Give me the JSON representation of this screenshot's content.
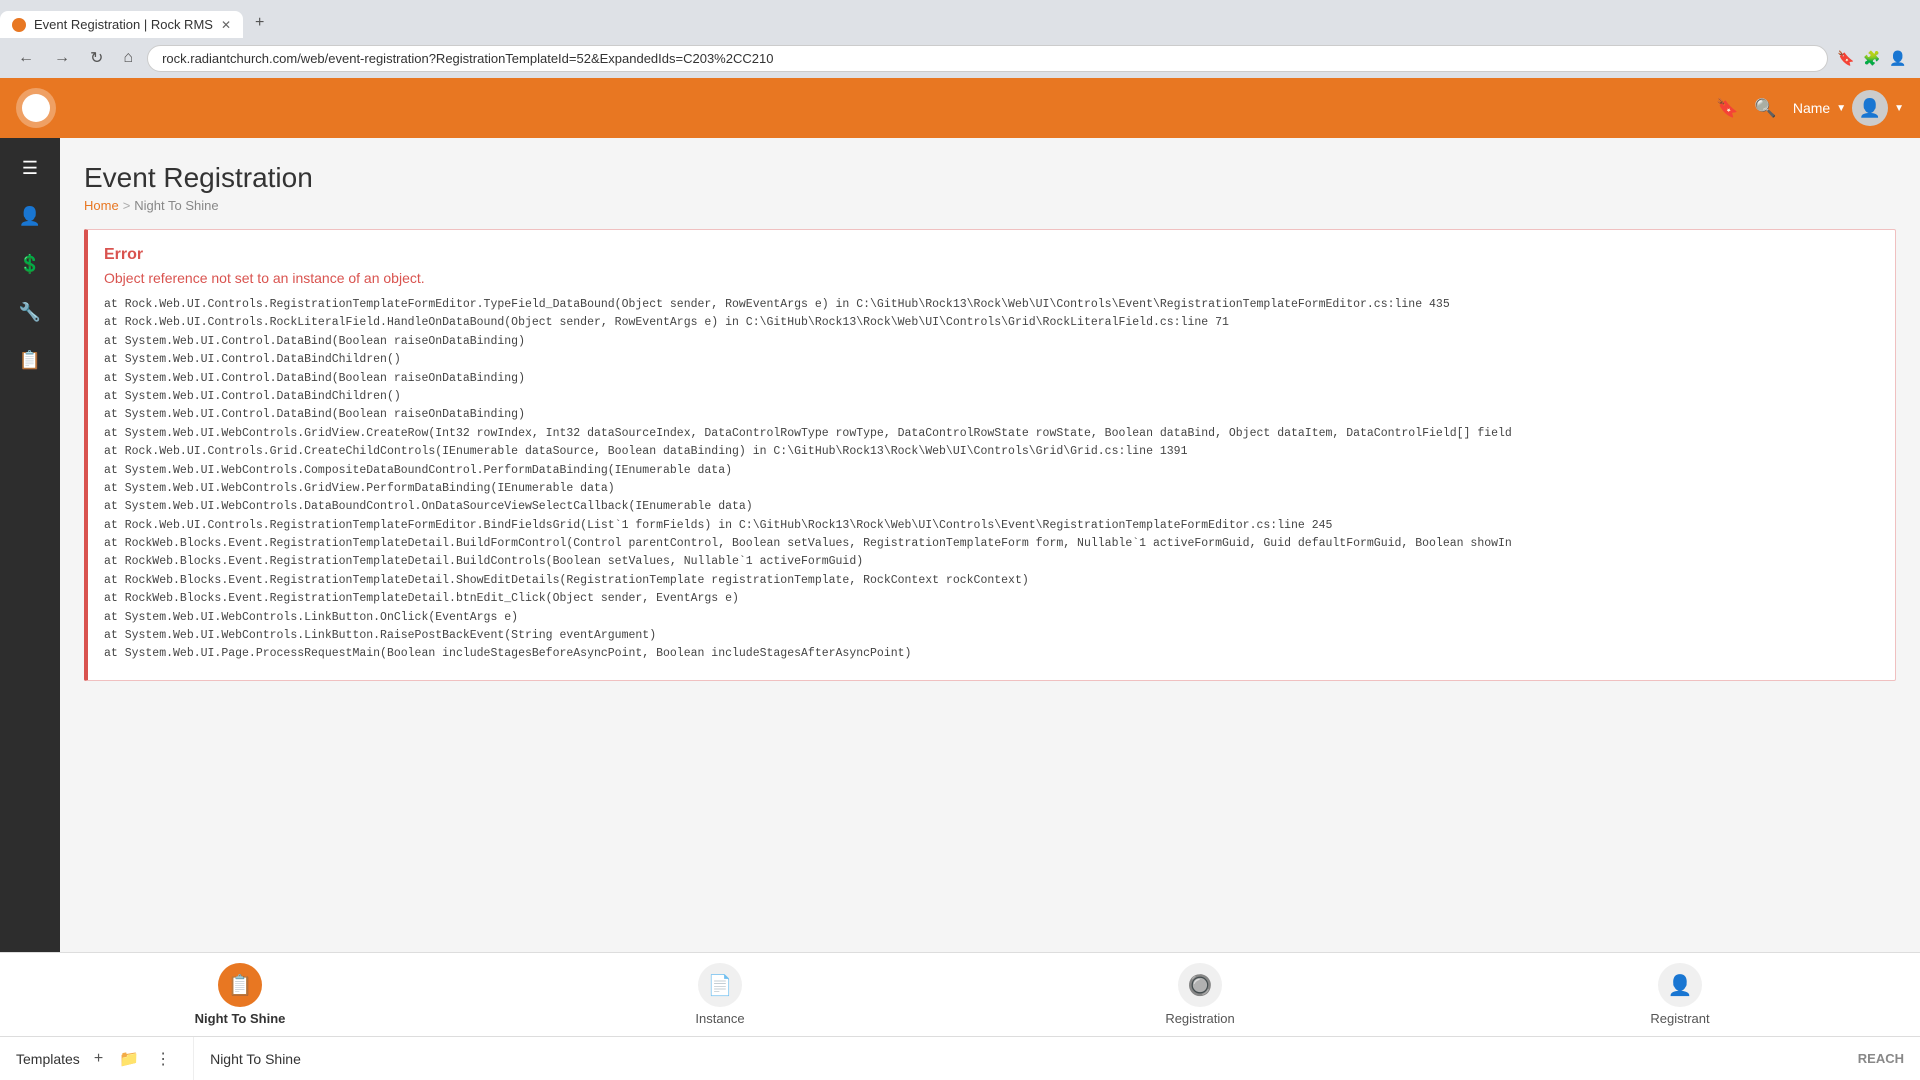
{
  "browser": {
    "tab_title": "Event Registration | Rock RMS",
    "tab_favicon": "🪨",
    "url": "rock.radiantchurch.com/web/event-registration?RegistrationTemplateId=52&ExpandedIds=C203%2CC210",
    "nav_back": "←",
    "nav_forward": "→",
    "nav_refresh": "↻",
    "nav_home": "⌂"
  },
  "top_nav": {
    "user_name": "Name",
    "bookmark_icon": "bookmark",
    "search_icon": "search"
  },
  "sidebar": {
    "items": [
      {
        "icon": "☰",
        "name": "menu"
      },
      {
        "icon": "👤",
        "name": "person"
      },
      {
        "icon": "💲",
        "name": "finance"
      },
      {
        "icon": "🔧",
        "name": "tools"
      },
      {
        "icon": "📋",
        "name": "reports"
      }
    ]
  },
  "page": {
    "title": "Event Registration",
    "breadcrumb_home": "Home",
    "breadcrumb_sep": ">",
    "breadcrumb_current": "Night To Shine"
  },
  "error": {
    "title": "Error",
    "message": "Object reference not set to an instance of an object.",
    "stack_lines": [
      "   at Rock.Web.UI.Controls.RegistrationTemplateFormEditor.TypeField_DataBound(Object sender, RowEventArgs e) in C:\\GitHub\\Rock13\\Rock\\Web\\UI\\Controls\\Event\\RegistrationTemplateFormEditor.cs:line 435",
      "   at Rock.Web.UI.Controls.RockLiteralField.HandleOnDataBound(Object sender, RowEventArgs e) in C:\\GitHub\\Rock13\\Rock\\Web\\UI\\Controls\\Grid\\RockLiteralField.cs:line 71",
      "   at System.Web.UI.Control.DataBind(Boolean raiseOnDataBinding)",
      "   at System.Web.UI.Control.DataBindChildren()",
      "   at System.Web.UI.Control.DataBind(Boolean raiseOnDataBinding)",
      "   at System.Web.UI.Control.DataBindChildren()",
      "   at System.Web.UI.Control.DataBind(Boolean raiseOnDataBinding)",
      "   at System.Web.UI.WebControls.GridView.CreateRow(Int32 rowIndex, Int32 dataSourceIndex, DataControlRowType rowType, DataControlRowState rowState, Boolean dataBind, Object dataItem, DataControlField[] field",
      "   at Rock.Web.UI.Controls.Grid.CreateChildControls(IEnumerable dataSource, Boolean dataBinding) in C:\\GitHub\\Rock13\\Rock\\Web\\UI\\Controls\\Grid\\Grid.cs:line 1391",
      "   at System.Web.UI.WebControls.CompositeDataBoundControl.PerformDataBinding(IEnumerable data)",
      "   at System.Web.UI.WebControls.GridView.PerformDataBinding(IEnumerable data)",
      "   at System.Web.UI.WebControls.DataBoundControl.OnDataSourceViewSelectCallback(IEnumerable data)",
      "   at Rock.Web.UI.Controls.RegistrationTemplateFormEditor.BindFieldsGrid(List`1 formFields) in C:\\GitHub\\Rock13\\Rock\\Web\\UI\\Controls\\Event\\RegistrationTemplateFormEditor.cs:line 245",
      "   at RockWeb.Blocks.Event.RegistrationTemplateDetail.BuildFormControl(Control parentControl, Boolean setValues, RegistrationTemplateForm form, Nullable`1 activeFormGuid, Guid defaultFormGuid, Boolean showIn",
      "   at RockWeb.Blocks.Event.RegistrationTemplateDetail.BuildControls(Boolean setValues, Nullable`1 activeFormGuid)",
      "   at RockWeb.Blocks.Event.RegistrationTemplateDetail.ShowEditDetails(RegistrationTemplate registrationTemplate, RockContext rockContext)",
      "   at RockWeb.Blocks.Event.RegistrationTemplateDetail.btnEdit_Click(Object sender, EventArgs e)",
      "   at System.Web.UI.WebControls.LinkButton.OnClick(EventArgs e)",
      "   at System.Web.UI.WebControls.LinkButton.RaisePostBackEvent(String eventArgument)",
      "   at System.Web.UI.Page.ProcessRequestMain(Boolean includeStagesBeforeAsyncPoint, Boolean includeStagesAfterAsyncPoint)"
    ]
  },
  "bottom_tabs": [
    {
      "label": "Night To Shine",
      "active": true,
      "icon": "📋"
    },
    {
      "label": "Instance",
      "active": false,
      "icon": "📄"
    },
    {
      "label": "Registration",
      "active": false,
      "icon": "🔘"
    },
    {
      "label": "Registrant",
      "active": false,
      "icon": "👤"
    }
  ],
  "bottom_panel": {
    "section_label": "Templates",
    "add_btn": "+",
    "folder_btn": "📁",
    "more_btn": "⋮",
    "item_label": "Night To Shine",
    "reach_label": "REACH"
  }
}
